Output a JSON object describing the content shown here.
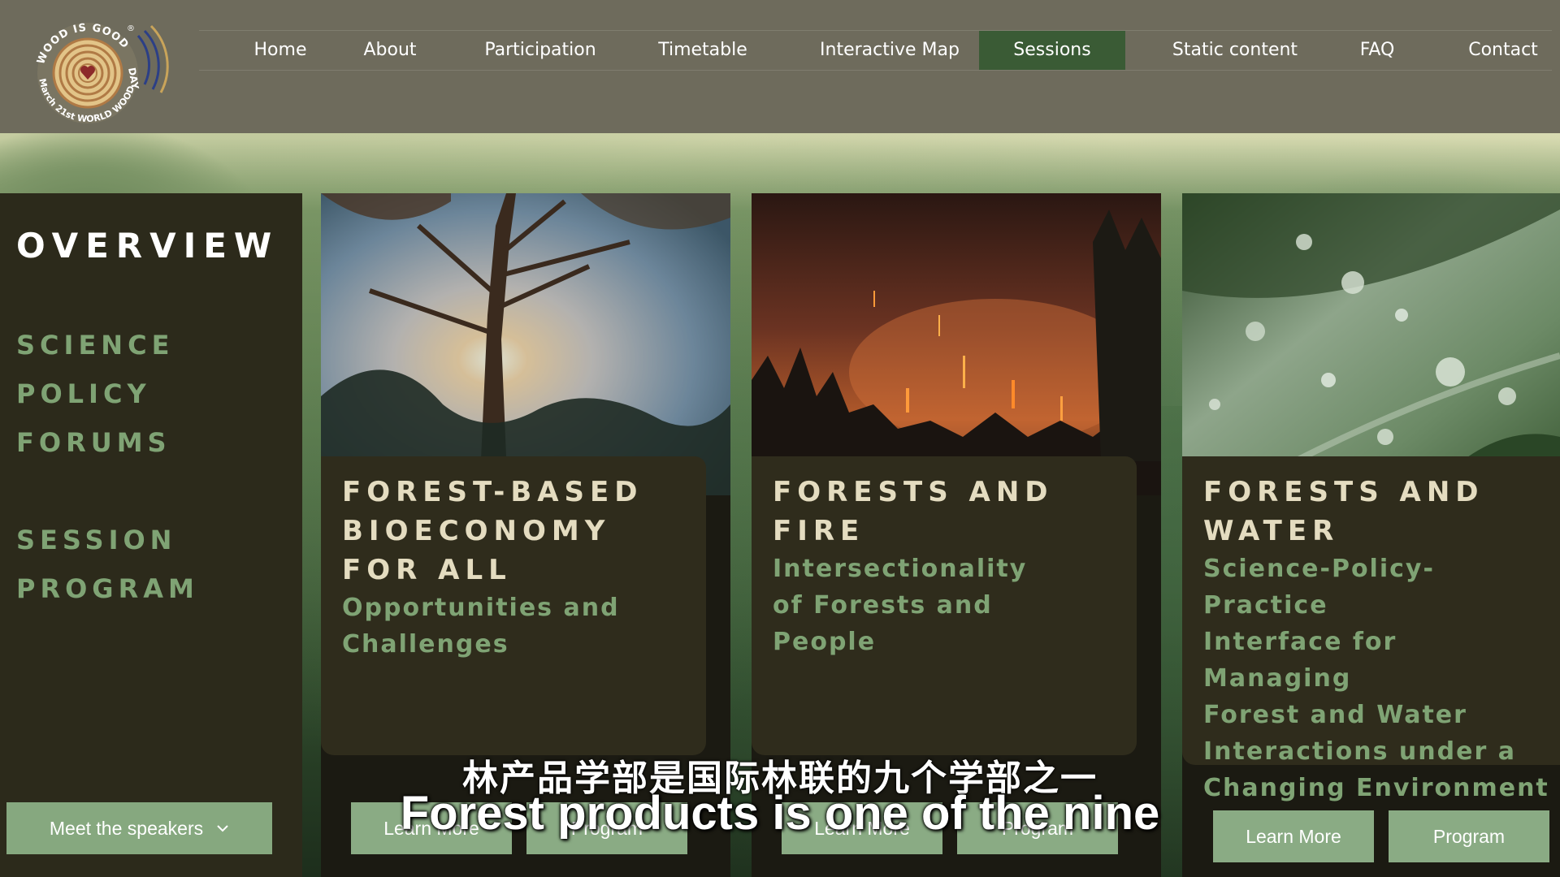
{
  "logo": {
    "ring_text_top": "WOOD IS GOOD",
    "ring_text_side": "DAY",
    "ring_text_bottom": "March 21st WORLD WOOD",
    "registered_mark": "®"
  },
  "nav": {
    "items": [
      {
        "label": "Home"
      },
      {
        "label": "About"
      },
      {
        "label": "Participation"
      },
      {
        "label": "Timetable"
      },
      {
        "label": "Interactive Map"
      },
      {
        "label": "Sessions",
        "active": true
      },
      {
        "label": "Static content"
      },
      {
        "label": "FAQ"
      },
      {
        "label": "Contact"
      }
    ]
  },
  "sidebar": {
    "heading": "OVERVIEW",
    "links": [
      "SCIENCE",
      "POLICY",
      "FORUMS",
      "SESSION",
      "PROGRAM"
    ],
    "speakers_button": "Meet the speakers"
  },
  "cards": [
    {
      "title": [
        "FOREST-BASED",
        "BIOECONOMY",
        "FOR ALL"
      ],
      "subtitle": [
        "Opportunities and",
        "Challenges"
      ],
      "learn_more": "Learn More",
      "program": "Program",
      "image": "sunlight-through-tree"
    },
    {
      "title": [
        "FORESTS AND",
        "FIRE"
      ],
      "subtitle": [
        "Intersectionality",
        "of Forests and",
        "People"
      ],
      "learn_more": "Learn More",
      "program": "Program",
      "image": "forest-fire-night"
    },
    {
      "title": [
        "FORESTS AND",
        "WATER"
      ],
      "subtitle": [
        "Science-Policy-Practice",
        "Interface for Managing",
        "Forest and Water",
        "Interactions under a",
        "Changing Environment"
      ],
      "learn_more": "Learn More",
      "program": "Program",
      "image": "water-droplets-leaf"
    }
  ],
  "subtitles": {
    "chinese": "林产品学部是国际林联的九个学部之一",
    "english": "Forest products is one of the nine"
  },
  "colors": {
    "header_bg": "#6e6b5c",
    "nav_active": "#3a5b35",
    "panel_bg": "#2f2c1c",
    "accent_green": "#7fa374",
    "button_green": "#8aab84"
  }
}
